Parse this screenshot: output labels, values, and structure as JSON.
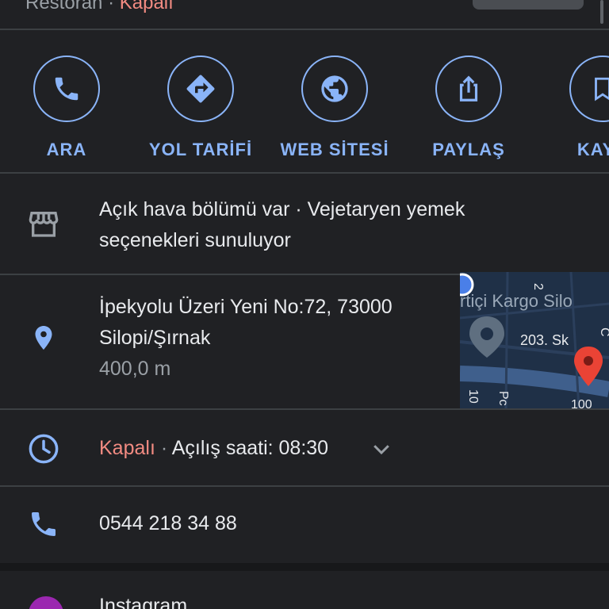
{
  "header": {
    "category": "Restoran",
    "separator": "·",
    "status": "Kapalı"
  },
  "actions": [
    {
      "label": "ARA",
      "icon": "phone-icon"
    },
    {
      "label": "YOL TARİFİ",
      "icon": "directions-icon"
    },
    {
      "label": "WEB SİTESİ",
      "icon": "globe-icon"
    },
    {
      "label": "PAYLAŞ",
      "icon": "share-icon"
    },
    {
      "label": "KAYD",
      "icon": "bookmark-icon"
    }
  ],
  "features": {
    "line1": "Açık hava bölümü var · Vejetaryen yemek",
    "line2": "seçenekleri sunuluyor",
    "icon": "storefront-icon"
  },
  "address": {
    "line1": "İpekyolu Üzeri Yeni No:72, 73000",
    "line2": "Silopi/Şırnak",
    "distance": "400,0 m",
    "icon": "location-pin-icon"
  },
  "map": {
    "label_kargo": "rtiçi Kargo Silo",
    "label_street": "203. Sk",
    "label_2": "2",
    "label_10": "10",
    "label_pc": "Pc",
    "label_100": "100",
    "label_c": "C"
  },
  "hours": {
    "status": "Kapalı",
    "separator": "·",
    "opening": "Açılış saati: 08:30",
    "icon": "clock-icon"
  },
  "phone": {
    "number": "0544 218 34 88",
    "icon": "phone-icon"
  },
  "instagram": {
    "label": "Instagram",
    "icon": "instagram-icon"
  },
  "colors": {
    "background": "#202124",
    "accent": "#8ab4f8",
    "closed": "#f28b82",
    "muted": "#9aa0a6"
  }
}
